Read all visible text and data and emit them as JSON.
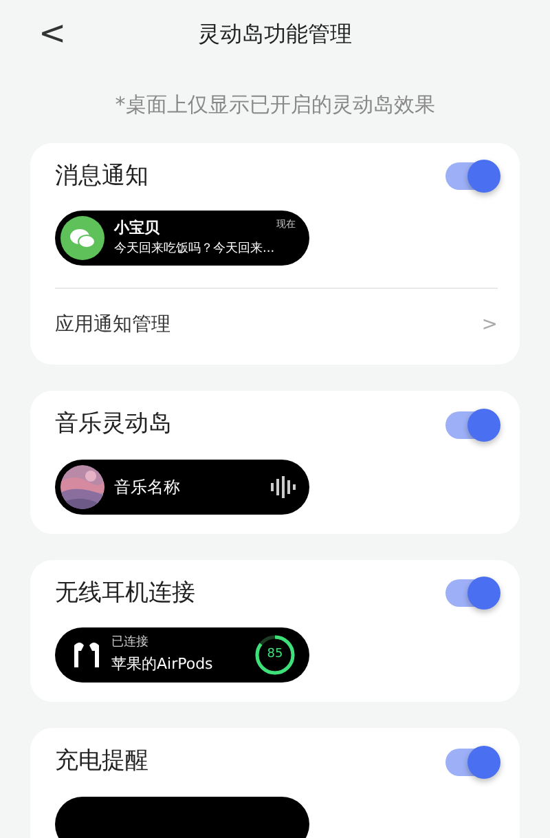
{
  "header": {
    "back": "<",
    "title": "灵动岛功能管理"
  },
  "note": "*桌面上仅显示已开启的灵动岛效果",
  "cards": [
    {
      "kind": "message",
      "title": "消息通知",
      "on": true,
      "pill": {
        "sender": "小宝贝",
        "time": "现在",
        "text": "今天回来吃饭吗？今天回来..."
      },
      "link": {
        "label": "应用通知管理",
        "chevron": ">"
      }
    },
    {
      "kind": "music",
      "title": "音乐灵动岛",
      "on": true,
      "pill": {
        "song": "音乐名称"
      }
    },
    {
      "kind": "earbuds",
      "title": "无线耳机连接",
      "on": true,
      "pill": {
        "status": "已连接",
        "device": "苹果的AirPods",
        "battery": "85"
      }
    },
    {
      "kind": "charging",
      "title": "充电提醒",
      "on": true
    }
  ]
}
